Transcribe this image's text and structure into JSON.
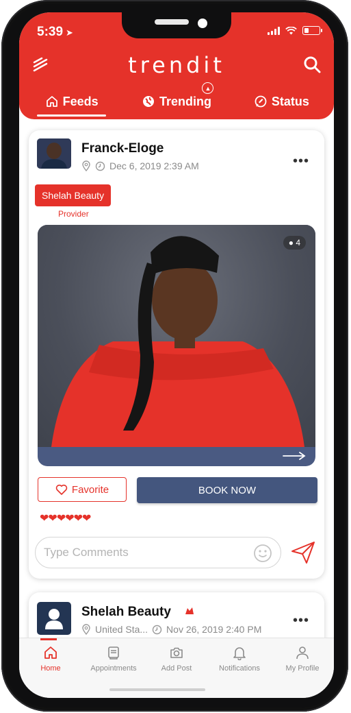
{
  "status_bar": {
    "time": "5:39"
  },
  "header": {
    "logo": "trendit",
    "tabs": [
      {
        "label": "Feeds",
        "active": true,
        "icon": "home-icon"
      },
      {
        "label": "Trending",
        "active": false,
        "icon": "globe-icon"
      },
      {
        "label": "Status",
        "active": false,
        "icon": "chat-icon"
      }
    ]
  },
  "post1": {
    "author": "Franck-Eloge",
    "date": "Dec 6, 2019 2:39 AM",
    "tag": "Shelah Beauty",
    "tag_role": "Provider",
    "views": "4",
    "favorite_label": "Favorite",
    "book_label": "BOOK NOW",
    "hearts": "❤❤❤❤❤❤",
    "comment_placeholder": "Type Comments"
  },
  "post2": {
    "author": "Shelah Beauty",
    "location": "United Sta...",
    "date": "Nov 26, 2019 2:40 PM"
  },
  "bottom_nav": [
    {
      "label": "Home",
      "active": true
    },
    {
      "label": "Appointments",
      "active": false
    },
    {
      "label": "Add Post",
      "active": false
    },
    {
      "label": "Notifications",
      "active": false
    },
    {
      "label": "My Profile",
      "active": false
    }
  ],
  "colors": {
    "accent": "#e5322a",
    "button_dark": "#44567e"
  }
}
